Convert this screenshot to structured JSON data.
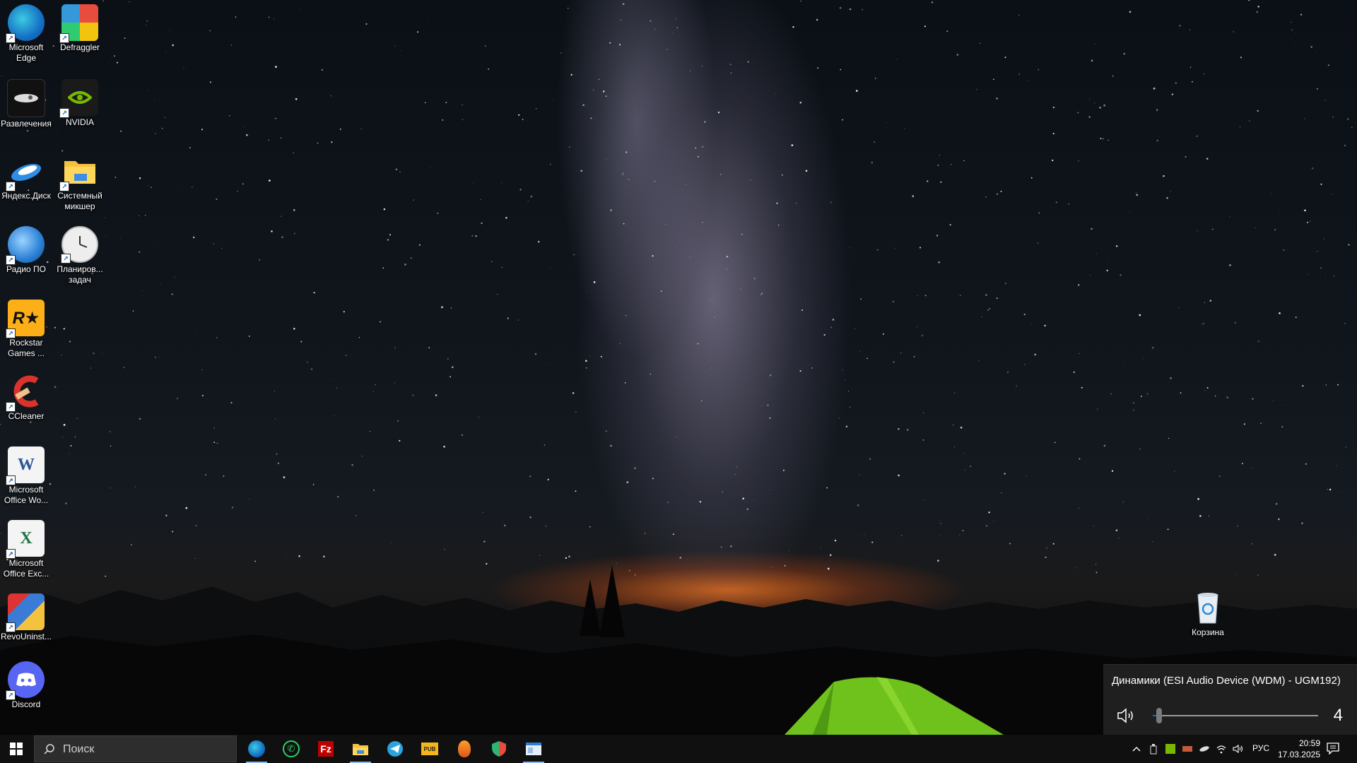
{
  "desktop": {
    "icons": [
      {
        "label": "Microsoft Edge",
        "icon": "edge-icon"
      },
      {
        "label": "Defraggler",
        "icon": "defraggler-icon"
      },
      {
        "label": "Развлечения",
        "icon": "entertainment-icon"
      },
      {
        "label": "NVIDIA",
        "icon": "nvidia-icon"
      },
      {
        "label": "Яндекс.Диск",
        "icon": "yandex-disk-icon"
      },
      {
        "label": "Системный микшер",
        "icon": "folder-icon"
      },
      {
        "label": "Радио ПО",
        "icon": "radio-icon"
      },
      {
        "label": "Планиров... задач",
        "icon": "task-scheduler-icon"
      },
      {
        "label": "Rockstar Games ...",
        "icon": "rockstar-icon"
      },
      {
        "label": "CCleaner",
        "icon": "ccleaner-icon"
      },
      {
        "label": "Microsoft Office Wo...",
        "icon": "word-icon"
      },
      {
        "label": "Microsoft Office Exc...",
        "icon": "excel-icon"
      },
      {
        "label": "RevoUninst...",
        "icon": "revo-uninstaller-icon"
      },
      {
        "label": "Discord",
        "icon": "discord-icon"
      },
      {
        "label": "Корзина",
        "icon": "recycle-bin-icon"
      }
    ]
  },
  "volume_flyout": {
    "device": "Динамики (ESI Audio Device (WDM) - UGM192)",
    "level": 4,
    "level_text": "4"
  },
  "taskbar": {
    "search_placeholder": "Поиск",
    "pinned": [
      {
        "name": "edge",
        "icon": "edge-icon",
        "active": true
      },
      {
        "name": "whatsapp",
        "icon": "whatsapp-icon",
        "active": false
      },
      {
        "name": "filezilla",
        "icon": "filezilla-icon",
        "active": false
      },
      {
        "name": "file-explorer",
        "icon": "folder-icon",
        "active": true
      },
      {
        "name": "telegram",
        "icon": "telegram-icon",
        "active": false
      },
      {
        "name": "pubg",
        "icon": "pubg-icon",
        "active": false
      },
      {
        "name": "fl-studio",
        "icon": "fl-studio-icon",
        "active": false
      },
      {
        "name": "vpn",
        "icon": "shield-icon",
        "active": false
      },
      {
        "name": "window-app",
        "icon": "window-icon",
        "active": true
      }
    ],
    "tray": {
      "language": "РУС",
      "time": "20:59",
      "date": "17.03.2025"
    }
  },
  "colors": {
    "taskbar_bg": "#101010",
    "flyout_bg": "#1f1f1f",
    "accent": "#0078d7"
  }
}
